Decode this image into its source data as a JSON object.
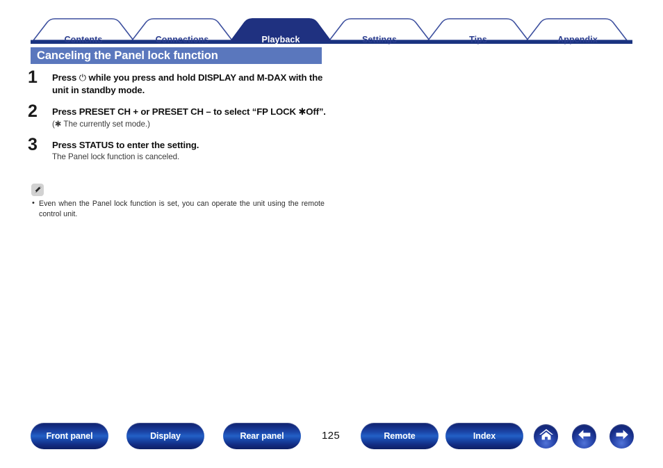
{
  "document": {
    "page_number": "125"
  },
  "colors": {
    "tab_active_fill": "#1f3180",
    "tab_outline": "#3c4f9e",
    "tab_text": "#2c3e8f",
    "tab_active_text": "#ffffff",
    "rule_bar": "#1a3380",
    "section_title_bg": "#5a77bd",
    "button_blue": "#1b44a6",
    "note_icon_bg": "#d2d2d2"
  },
  "tabs": [
    {
      "label": "Contents",
      "active": false
    },
    {
      "label": "Connections",
      "active": false
    },
    {
      "label": "Playback",
      "active": true
    },
    {
      "label": "Settings",
      "active": false
    },
    {
      "label": "Tips",
      "active": false
    },
    {
      "label": "Appendix",
      "active": false
    }
  ],
  "section": {
    "title": "Canceling the Panel lock function"
  },
  "steps": [
    {
      "number": "1",
      "head_pre": "Press ",
      "head_symbol": "⏻",
      "head_post": " while you press and hold DISPLAY and M-DAX with the unit in standby mode.",
      "sub": ""
    },
    {
      "number": "2",
      "head_pre": "Press PRESET CH + or PRESET CH – to select “FP LOCK ",
      "head_symbol": "✱",
      "head_post": "Off”.",
      "sub": "(✱ The currently set mode.)"
    },
    {
      "number": "3",
      "head_pre": "Press STATUS to enter the setting.",
      "head_symbol": "",
      "head_post": "",
      "sub": "The Panel lock function is canceled."
    }
  ],
  "note": {
    "icon": "pencil-icon",
    "items": [
      "Even when the Panel lock function is set, you can operate the unit using the remote control unit."
    ]
  },
  "bottom_nav": {
    "buttons": [
      {
        "label": "Front panel"
      },
      {
        "label": "Display"
      },
      {
        "label": "Rear panel"
      },
      {
        "label": "Remote"
      },
      {
        "label": "Index"
      }
    ],
    "icons": [
      {
        "name": "home-icon"
      },
      {
        "name": "arrow-left-icon"
      },
      {
        "name": "arrow-right-icon"
      }
    ]
  }
}
